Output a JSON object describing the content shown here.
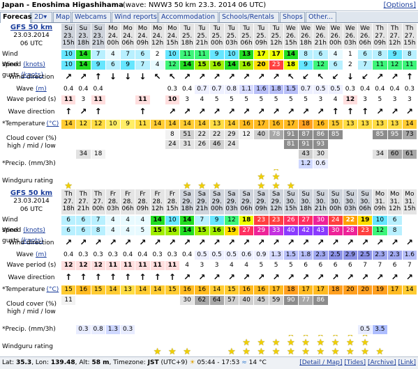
{
  "title": {
    "location": "Japan - Enoshima Higashihama",
    "wave_info": "(wave: NWW3 50 km 23.3. 2014 06 UTC)",
    "options": "[Options]"
  },
  "tabs": [
    "Forecast",
    "2D",
    "Map",
    "Webcams",
    "Wind reports",
    "Accommodation",
    "Schools/Rentals",
    "Shops",
    "Other..."
  ],
  "labels": {
    "wind_speed": "Wind speed",
    "wind_gusts": "Wind gusts",
    "knots": "(knots)",
    "wind_direction": "Wind direction",
    "wave": "Wave",
    "wave_unit": "(m)",
    "wave_period": "Wave period (s)",
    "wave_direction": "Wave direction",
    "temperature": "*Temperature",
    "temp_unit": "(°C)",
    "cloud_cover": "Cloud cover (%)",
    "cloud_sub": "high / mid / low",
    "precip": "*Precip. (mm/3h)",
    "rating": "Windguru rating"
  },
  "panels": [
    {
      "model": "GFS 50 km",
      "date": "23.03.2014",
      "time": "06 UTC",
      "days": [
        "Su",
        "Su",
        "Su",
        "Mo",
        "Mo",
        "Mo",
        "Mo",
        "Mo",
        "Tu",
        "Tu",
        "Tu",
        "Tu",
        "Tu",
        "Tu",
        "Tu",
        "We",
        "We",
        "We",
        "We",
        "We",
        "We",
        "Th",
        "Th",
        "Th"
      ],
      "dates": [
        "23.",
        "23.",
        "23.",
        "24.",
        "24.",
        "24.",
        "24.",
        "24.",
        "25.",
        "25.",
        "25.",
        "25.",
        "25.",
        "25.",
        "25.",
        "26.",
        "26.",
        "26.",
        "26.",
        "26.",
        "26.",
        "27.",
        "27.",
        "27."
      ],
      "hours": [
        "15h",
        "18h",
        "21h",
        "00h",
        "06h",
        "09h",
        "12h",
        "15h",
        "18h",
        "21h",
        "00h",
        "03h",
        "06h",
        "09h",
        "12h",
        "15h",
        "18h",
        "21h",
        "00h",
        "03h",
        "06h",
        "09h",
        "12h",
        "15h"
      ],
      "wind_speed": [
        "10",
        "14",
        "7",
        "4",
        "7",
        "6",
        "2",
        "10",
        "11",
        "11",
        "9",
        "10",
        "13",
        "17",
        "17",
        "14",
        "8",
        "6",
        "4",
        "1",
        "6",
        "8",
        "9",
        "8"
      ],
      "wind_gusts": [
        "10",
        "14",
        "9",
        "6",
        "9",
        "7",
        "4",
        "12",
        "14",
        "15",
        "16",
        "14",
        "16",
        "20",
        "23",
        "18",
        "9",
        "12",
        "6",
        "2",
        "7",
        "11",
        "12",
        "11"
      ],
      "wind_dir": [
        "↗",
        "↗",
        "↑",
        "↓",
        "↓",
        "↓",
        "↖",
        "↖",
        "↗",
        "↗",
        "↗",
        "↗",
        "↗",
        "↗",
        "↗",
        "↖",
        "↙",
        "↖",
        "↙",
        "↓",
        "↙",
        "↗",
        "↗",
        "↑"
      ],
      "wave": [
        "0.4",
        "0.4",
        "0.4",
        "",
        "",
        "",
        "",
        "0.3",
        "0.4",
        "0.7",
        "0.7",
        "0.8",
        "1.1",
        "1.6",
        "1.8",
        "1.5",
        "0.7",
        "0.5",
        "0.5",
        "0.3",
        "0.4",
        "0.4",
        "0.4",
        "0.3"
      ],
      "wave_period": [
        "11",
        "3",
        "11",
        "",
        "",
        "11",
        "",
        "10",
        "3",
        "4",
        "5",
        "5",
        "5",
        "5",
        "5",
        "5",
        "5",
        "3",
        "4",
        "12",
        "3",
        "5",
        "3",
        "3"
      ],
      "wave_dir": [
        "↑",
        "↗",
        "↑",
        "",
        "",
        "↑",
        "",
        "↗",
        "↗",
        "↗",
        "↗",
        "↗",
        "↗",
        "↗",
        "↗",
        "↗",
        "↗",
        "↗",
        "↑",
        "↑",
        "↑",
        "↗",
        "↗",
        "↗"
      ],
      "temperature": [
        "14",
        "12",
        "12",
        "10",
        "9",
        "11",
        "14",
        "14",
        "14",
        "14",
        "13",
        "14",
        "16",
        "17",
        "16",
        "17",
        "18",
        "16",
        "15",
        "13",
        "13",
        "13",
        "13",
        "14"
      ],
      "cloud_high": [
        "",
        "",
        "",
        "",
        "",
        "",
        "",
        "8",
        "51",
        "22",
        "22",
        "29",
        "12",
        "40",
        "78",
        "91",
        "87",
        "86",
        "85",
        "",
        "",
        "85",
        "95",
        "73"
      ],
      "cloud_mid": [
        "",
        "",
        "",
        "",
        "",
        "",
        "",
        "24",
        "31",
        "26",
        "46",
        "24",
        "",
        "",
        "",
        "81",
        "91",
        "93",
        "",
        "",
        "",
        "",
        "",
        ""
      ],
      "cloud_low": [
        "",
        "34",
        "18",
        "",
        "",
        "",
        "",
        "",
        "",
        "",
        "",
        "",
        "",
        "",
        "",
        "",
        "43",
        "30",
        "",
        "",
        "",
        "34",
        "60",
        "61"
      ],
      "precip": [
        "",
        "",
        "",
        "",
        "",
        "",
        "",
        "",
        "",
        "",
        "",
        "",
        "",
        "",
        "",
        "",
        "1.2",
        "0.6",
        "",
        "",
        "",
        "",
        "",
        ""
      ],
      "rating": [
        1,
        0,
        0,
        0,
        0,
        0,
        0,
        0,
        1,
        1,
        1,
        0,
        0,
        2,
        3,
        1,
        0,
        0,
        0,
        0,
        0,
        0,
        0,
        0
      ]
    },
    {
      "model": "GFS 50 km",
      "date": "23.03.2014",
      "time": "06 UTC",
      "days": [
        "Th",
        "Th",
        "Th",
        "Fr",
        "Fr",
        "Fr",
        "Fr",
        "Fr",
        "Sa",
        "Sa",
        "Sa",
        "Sa",
        "Sa",
        "Sa",
        "Sa",
        "Su",
        "Su",
        "Su",
        "Su",
        "Su",
        "Su",
        "Mo",
        "Mo",
        "Mo"
      ],
      "dates": [
        "27.",
        "27.",
        "27.",
        "28.",
        "28.",
        "28.",
        "28.",
        "28.",
        "29.",
        "29.",
        "29.",
        "29.",
        "29.",
        "29.",
        "29.",
        "30.",
        "30.",
        "30.",
        "30.",
        "30.",
        "30.",
        "31.",
        "31.",
        "31."
      ],
      "hours": [
        "18h",
        "21h",
        "00h",
        "03h",
        "06h",
        "09h",
        "12h",
        "15h",
        "18h",
        "21h",
        "00h",
        "03h",
        "06h",
        "09h",
        "12h",
        "15h",
        "18h",
        "21h",
        "00h",
        "03h",
        "06h",
        "09h",
        "12h",
        "15h"
      ],
      "wind_speed": [
        "6",
        "6",
        "7",
        "4",
        "4",
        "4",
        "14",
        "10",
        "14",
        "7",
        "9",
        "12",
        "18",
        "23",
        "23",
        "26",
        "27",
        "30",
        "24",
        "22",
        "19",
        "10",
        "6",
        ""
      ],
      "wind_gusts": [
        "6",
        "6",
        "8",
        "4",
        "4",
        "5",
        "15",
        "16",
        "14",
        "15",
        "16",
        "19",
        "27",
        "29",
        "33",
        "40",
        "42",
        "43",
        "30",
        "28",
        "23",
        "12",
        "8",
        ""
      ],
      "wind_dir": [
        "↗",
        "↗",
        "↗",
        "↗",
        "↗",
        "↗",
        "↗",
        "↗",
        "↗",
        "↗",
        "↗",
        "↗",
        "↗",
        "↗",
        "↗",
        "↗",
        "↗",
        "↗",
        "↗",
        "↗",
        "↗",
        "↗",
        "↗",
        "↗"
      ],
      "wave": [
        "0.4",
        "0.3",
        "0.3",
        "0.3",
        "0.4",
        "0.4",
        "0.3",
        "0.3",
        "0.4",
        "0.5",
        "0.5",
        "0.5",
        "0.6",
        "0.9",
        "1.3",
        "1.5",
        "1.8",
        "2.3",
        "2.5",
        "2.9",
        "2.5",
        "2.3",
        "2.3",
        "1.6"
      ],
      "wave_period": [
        "12",
        "12",
        "12",
        "11",
        "11",
        "11",
        "11",
        "11",
        "4",
        "3",
        "3",
        "4",
        "4",
        "5",
        "5",
        "5",
        "6",
        "6",
        "6",
        "6",
        "7",
        "7",
        "6",
        "7"
      ],
      "wave_dir": [
        "↑",
        "↑",
        "↑",
        "↑",
        "↑",
        "↑",
        "↑",
        "↑",
        "↗",
        "↗",
        "↗",
        "↗",
        "↗",
        "↗",
        "↗",
        "↗",
        "↗",
        "↗",
        "↗",
        "↗",
        "↗",
        "↗",
        "↗",
        "↗"
      ],
      "temperature": [
        "15",
        "16",
        "15",
        "14",
        "13",
        "14",
        "14",
        "15",
        "16",
        "16",
        "14",
        "15",
        "16",
        "16",
        "17",
        "18",
        "17",
        "17",
        "18",
        "20",
        "20",
        "19",
        "17",
        "14"
      ],
      "cloud_high": [
        "11",
        "",
        "",
        "",
        "",
        "",
        "",
        "",
        "30",
        "62",
        "64",
        "57",
        "40",
        "45",
        "59",
        "90",
        "77",
        "86",
        "",
        "",
        "",
        "",
        "",
        ""
      ],
      "cloud_mid": [
        "",
        "",
        "",
        "",
        "",
        "",
        "",
        "",
        "",
        "",
        "",
        "",
        "",
        "",
        "",
        "",
        "",
        "",
        "",
        "",
        "",
        "",
        "",
        ""
      ],
      "cloud_low": [
        "",
        "",
        "",
        "",
        "",
        "",
        "",
        "",
        "",
        "",
        "",
        "",
        "",
        "",
        "",
        "",
        "",
        "",
        "",
        "",
        "",
        "",
        "",
        ""
      ],
      "precip": [
        "",
        "0.3",
        "0.8",
        "1.3",
        "0.3",
        "",
        "",
        "",
        "",
        "",
        "",
        "",
        "",
        "",
        "",
        "",
        "",
        "",
        "",
        "",
        "0.5",
        "3.5",
        "",
        ""
      ],
      "rating": [
        0,
        0,
        0,
        0,
        0,
        0,
        1,
        1,
        1,
        0,
        0,
        1,
        2,
        2,
        2,
        3,
        3,
        3,
        3,
        3,
        3,
        1,
        0,
        0
      ]
    }
  ],
  "footer": {
    "lat_label": "Lat:",
    "lat": "35.3",
    "lon_label": "Lon:",
    "lon": "139.48",
    "alt_label": "Alt:",
    "alt": "58 m",
    "tz_label": "Timezone:",
    "tz": "JST",
    "tz_offset": "(UTC+9)",
    "sun": "05:44 - 17:53",
    "water_temp": "14 °C",
    "links": [
      "[Detail / Map]",
      "[Tides]",
      "[Archive]",
      "[Link]"
    ]
  }
}
